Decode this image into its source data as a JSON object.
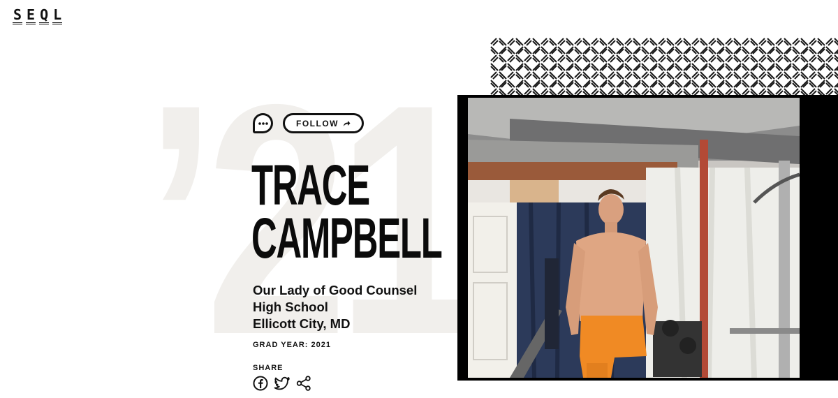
{
  "brand": {
    "logo_letters": [
      "S",
      "E",
      "Q",
      "L"
    ]
  },
  "profile": {
    "year_watermark": "’21",
    "follow_label": "FOLLOW",
    "name_line1": "TRACE",
    "name_line2": "CAMPBELL",
    "school_line1": "Our Lady of Good Counsel",
    "school_line2": "High School",
    "location": "Ellicott City, MD",
    "grad_label": "GRAD YEAR:",
    "grad_year": "2021",
    "share_label": "SHARE"
  },
  "icons": {
    "message": "chat-bubble-icon",
    "follow_arrow": "arrow-forward-icon",
    "facebook": "facebook-icon",
    "twitter": "twitter-icon",
    "share": "share-icon"
  },
  "colors": {
    "text": "#111111",
    "watermark": "#f1efec",
    "video_frame": "#000000",
    "shorts": "#f08a24"
  }
}
